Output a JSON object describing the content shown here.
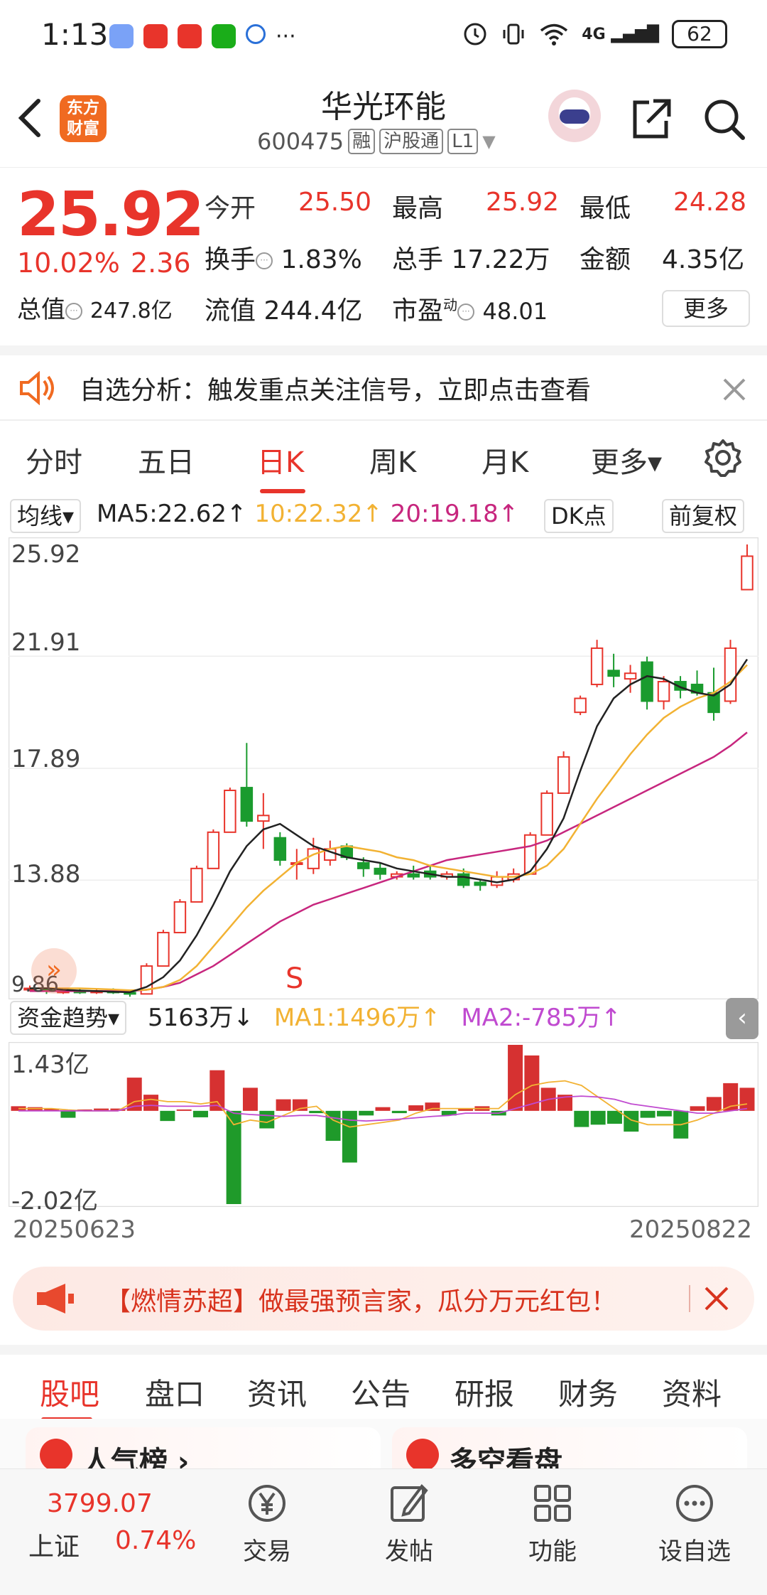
{
  "status": {
    "time": "1:13",
    "more": "···",
    "battery": "62",
    "net": "4G"
  },
  "header": {
    "title": "华光环能",
    "code": "600475",
    "tags": [
      "融",
      "沪股通",
      "L1"
    ],
    "logo_text": "东方财富"
  },
  "quote": {
    "price": "25.92",
    "pct": "10.02%",
    "change": "2.36",
    "open_label": "今开",
    "open": "25.50",
    "high_label": "最高",
    "high": "25.92",
    "low_label": "最低",
    "low": "24.28",
    "turnover_label": "换手",
    "turnover": "1.83%",
    "volume_label": "总手",
    "volume": "17.22万",
    "amount_label": "金额",
    "amount": "4.35亿",
    "mktcap_label": "总值",
    "mktcap": "247.8亿",
    "float_label": "流值",
    "float": "244.4亿",
    "pe_label": "市盈",
    "pe_sup": "动",
    "pe": "48.01",
    "more": "更多"
  },
  "notice": {
    "text": "自选分析：触发重点关注信号，立即点击查看"
  },
  "ktabs": [
    "分时",
    "五日",
    "日K",
    "周K",
    "月K",
    "更多▾"
  ],
  "chart_toolbar": {
    "ma_select": "均线▾",
    "ma5": "MA5:22.62↑",
    "ma10": "10:22.32↑",
    "ma20": "20:19.18↑",
    "dk": "DK点",
    "adjust": "前复权"
  },
  "colors": {
    "up": "#e8342b",
    "down": "#1a9b2e",
    "ma5": "#222222",
    "ma10": "#f2b233",
    "ma20": "#c7267e",
    "brand": "#f06a21"
  },
  "chart_data": [
    {
      "type": "candlestick",
      "ylim": [
        9.86,
        25.92
      ],
      "y_ticks": [
        "25.92",
        "21.91",
        "17.89",
        "13.88",
        "9.86"
      ],
      "x_labels": [
        "20250623",
        "20250822"
      ],
      "marker": "S",
      "candles": [
        [
          10.0,
          10.1,
          9.9,
          10.0
        ],
        [
          10.0,
          10.0,
          9.8,
          9.9
        ],
        [
          9.9,
          10.0,
          9.8,
          9.9
        ],
        [
          9.9,
          10.0,
          9.8,
          9.85
        ],
        [
          9.85,
          9.95,
          9.8,
          9.9
        ],
        [
          9.9,
          10.0,
          9.8,
          9.85
        ],
        [
          9.85,
          9.9,
          9.7,
          9.8
        ],
        [
          9.8,
          10.9,
          9.8,
          10.8
        ],
        [
          10.8,
          12.1,
          10.8,
          12.0
        ],
        [
          12.0,
          13.2,
          12.0,
          13.1
        ],
        [
          13.1,
          14.4,
          13.1,
          14.3
        ],
        [
          14.3,
          15.7,
          14.3,
          15.6
        ],
        [
          15.6,
          17.2,
          15.6,
          17.1
        ],
        [
          17.2,
          18.8,
          15.8,
          16.0
        ],
        [
          16.0,
          17.0,
          15.0,
          16.2
        ],
        [
          15.4,
          15.6,
          14.4,
          14.6
        ],
        [
          14.5,
          15.0,
          13.9,
          14.5
        ],
        [
          14.3,
          15.4,
          14.1,
          15.0
        ],
        [
          14.6,
          15.3,
          14.4,
          15.0
        ],
        [
          15.1,
          15.2,
          14.6,
          14.7
        ],
        [
          14.5,
          14.7,
          14.0,
          14.3
        ],
        [
          14.3,
          14.5,
          13.9,
          14.1
        ],
        [
          14.0,
          14.2,
          13.9,
          14.1
        ],
        [
          14.1,
          14.4,
          13.9,
          14.0
        ],
        [
          14.2,
          14.4,
          13.9,
          14.0
        ],
        [
          14.0,
          14.2,
          13.9,
          14.1
        ],
        [
          14.1,
          14.3,
          13.6,
          13.7
        ],
        [
          13.8,
          13.9,
          13.5,
          13.7
        ],
        [
          13.7,
          14.2,
          13.6,
          14.0
        ],
        [
          13.9,
          14.3,
          13.8,
          14.1
        ],
        [
          14.1,
          15.6,
          14.1,
          15.5
        ],
        [
          15.5,
          17.1,
          15.5,
          17.0
        ],
        [
          17.0,
          18.5,
          17.0,
          18.3
        ],
        [
          19.9,
          20.5,
          19.8,
          20.4
        ],
        [
          20.9,
          22.5,
          20.8,
          22.2
        ],
        [
          21.4,
          22.0,
          20.8,
          21.2
        ],
        [
          21.1,
          21.6,
          20.6,
          21.3
        ],
        [
          21.7,
          21.9,
          20.0,
          20.3
        ],
        [
          20.3,
          21.2,
          20.0,
          21.0
        ],
        [
          21.0,
          21.2,
          20.4,
          20.7
        ],
        [
          20.9,
          21.4,
          20.5,
          20.6
        ],
        [
          20.6,
          21.5,
          19.6,
          19.9
        ],
        [
          20.3,
          22.5,
          20.2,
          22.2
        ],
        [
          24.3,
          25.92,
          24.28,
          25.5
        ]
      ],
      "ma5": [
        10.0,
        10.0,
        9.95,
        9.92,
        9.9,
        9.88,
        9.86,
        10.05,
        10.4,
        11.0,
        11.9,
        13.0,
        14.2,
        15.1,
        15.7,
        15.9,
        15.5,
        15.1,
        14.9,
        14.7,
        14.6,
        14.5,
        14.3,
        14.2,
        14.1,
        14.0,
        14.0,
        13.9,
        13.8,
        13.9,
        14.2,
        15.0,
        16.1,
        17.8,
        19.4,
        20.4,
        20.9,
        21.2,
        21.1,
        20.8,
        20.6,
        20.5,
        20.9,
        21.8
      ],
      "ma10": [
        10.0,
        10.0,
        10.0,
        10.0,
        9.98,
        9.96,
        9.93,
        9.95,
        10.05,
        10.3,
        10.8,
        11.5,
        12.2,
        12.9,
        13.5,
        14.0,
        14.5,
        14.8,
        15.0,
        15.1,
        15.0,
        14.9,
        14.7,
        14.6,
        14.4,
        14.3,
        14.2,
        14.1,
        14.0,
        14.0,
        14.1,
        14.4,
        15.0,
        15.9,
        16.8,
        17.6,
        18.4,
        19.1,
        19.7,
        20.1,
        20.4,
        20.6,
        21.0,
        21.6
      ],
      "ma20": [
        9.9,
        9.9,
        9.9,
        9.9,
        9.9,
        9.9,
        9.9,
        9.95,
        10.05,
        10.2,
        10.5,
        10.8,
        11.2,
        11.6,
        12.0,
        12.4,
        12.7,
        13.0,
        13.2,
        13.4,
        13.6,
        13.8,
        14.0,
        14.2,
        14.4,
        14.6,
        14.7,
        14.8,
        14.9,
        15.0,
        15.1,
        15.3,
        15.6,
        15.9,
        16.2,
        16.5,
        16.8,
        17.1,
        17.4,
        17.7,
        18.0,
        18.3,
        18.7,
        19.18
      ]
    },
    {
      "type": "bar",
      "title": "资金趋势▾",
      "value": "5163万↓",
      "ma1": "MA1:1496万↑",
      "ma2": "MA2:-785万↑",
      "ylim": [
        -2.02,
        1.43
      ],
      "y_ticks": [
        "1.43亿",
        "-2.02亿"
      ],
      "values": [
        0.1,
        0.08,
        0.05,
        -0.15,
        0.03,
        0.05,
        0.05,
        0.72,
        0.35,
        -0.22,
        0.03,
        -0.14,
        0.88,
        -2.02,
        0.5,
        -0.38,
        0.25,
        0.25,
        -0.05,
        -0.65,
        -1.12,
        -0.1,
        0.08,
        -0.05,
        0.12,
        0.18,
        -0.1,
        0.05,
        0.1,
        -0.1,
        1.43,
        1.2,
        0.5,
        0.35,
        -0.35,
        -0.3,
        -0.28,
        -0.45,
        -0.15,
        -0.12,
        -0.6,
        0.1,
        0.3,
        0.6,
        0.5
      ],
      "ma1_values": [
        0.05,
        0.05,
        0.05,
        0.02,
        0.0,
        0.0,
        0.0,
        0.2,
        0.25,
        0.2,
        0.2,
        0.15,
        0.2,
        -0.3,
        -0.2,
        -0.25,
        -0.1,
        0.05,
        0.1,
        -0.2,
        -0.35,
        -0.3,
        -0.25,
        -0.2,
        -0.05,
        0.05,
        0.05,
        0.05,
        0.05,
        0.05,
        0.35,
        0.55,
        0.62,
        0.65,
        0.55,
        0.3,
        0.05,
        -0.2,
        -0.3,
        -0.3,
        -0.3,
        -0.2,
        -0.05,
        0.1,
        0.15
      ],
      "ma2_values": [
        0.0,
        0.0,
        0.0,
        0.0,
        0.0,
        0.0,
        0.0,
        0.1,
        0.12,
        0.1,
        0.1,
        0.1,
        0.12,
        -0.05,
        -0.08,
        -0.1,
        -0.12,
        -0.1,
        -0.1,
        -0.15,
        -0.2,
        -0.22,
        -0.2,
        -0.18,
        -0.15,
        -0.12,
        -0.1,
        -0.05,
        -0.05,
        -0.05,
        0.05,
        0.15,
        0.25,
        0.3,
        0.32,
        0.3,
        0.25,
        0.15,
        0.1,
        0.05,
        0.0,
        -0.05,
        -0.05,
        0.0,
        0.05
      ]
    }
  ],
  "banner": {
    "text": "【燃情苏超】做最强预言家，瓜分万元红包！"
  },
  "btabs": [
    "股吧",
    "盘口",
    "资讯",
    "公告",
    "研报",
    "财务",
    "资料"
  ],
  "cards": [
    "人气榜 ›",
    "多空看盘"
  ],
  "nav": {
    "index_value": "3799.07",
    "index_name": "上证",
    "index_pct": "0.74%",
    "items": [
      "交易",
      "发帖",
      "功能",
      "设自选"
    ]
  }
}
